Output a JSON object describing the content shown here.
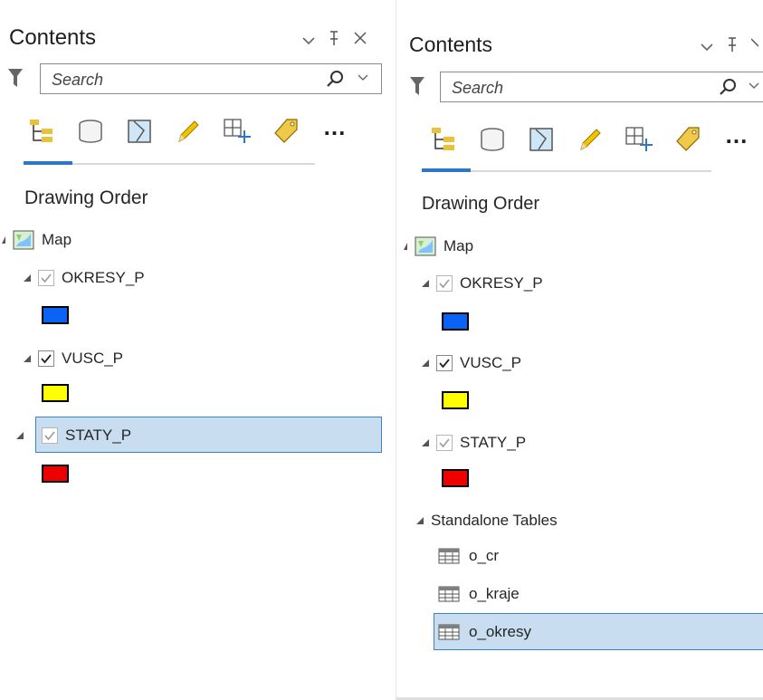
{
  "colors": {
    "accent": "#2a78c6",
    "selection_bg": "#c8ddf0",
    "selection_border": "#3d84c6",
    "okresy_fill": "#0b63f6",
    "vusc_fill": "#ffff00",
    "staty_fill": "#ee0000"
  },
  "left": {
    "title": "Contents",
    "window_controls": {
      "dropdown": "⌄",
      "pin": "ꟷ",
      "close": "✕"
    },
    "search": {
      "placeholder": "Search"
    },
    "toolbar_icons": [
      "list-by-drawing-order-icon",
      "list-by-data-source-icon",
      "list-by-selection-icon",
      "list-by-editing-icon",
      "list-by-snapping-icon",
      "list-by-labeling-icon"
    ],
    "more_label": "...",
    "section": "Drawing Order",
    "map_label": "Map",
    "layers": [
      {
        "label": "OKRESY_P",
        "checked": true,
        "swatch": "#0b63f6"
      },
      {
        "label": "VUSC_P",
        "checked": true,
        "swatch": "#ffff00"
      },
      {
        "label": "STATY_P",
        "checked": true,
        "swatch": "#ee0000",
        "selected": true
      }
    ]
  },
  "right": {
    "title": "Contents",
    "window_controls": {
      "dropdown": "⌄",
      "pin": "ꟷ",
      "close": "✕"
    },
    "search": {
      "placeholder": "Search"
    },
    "more_label": "...",
    "section": "Drawing Order",
    "map_label": "Map",
    "layers": [
      {
        "label": "OKRESY_P",
        "checked": true,
        "swatch": "#0b63f6"
      },
      {
        "label": "VUSC_P",
        "checked": true,
        "swatch": "#ffff00"
      },
      {
        "label": "STATY_P",
        "checked": true,
        "swatch": "#ee0000"
      }
    ],
    "standalone_tables": {
      "label": "Standalone Tables",
      "items": [
        {
          "label": "o_cr"
        },
        {
          "label": "o_kraje"
        },
        {
          "label": "o_okresy",
          "selected": true
        }
      ]
    }
  }
}
